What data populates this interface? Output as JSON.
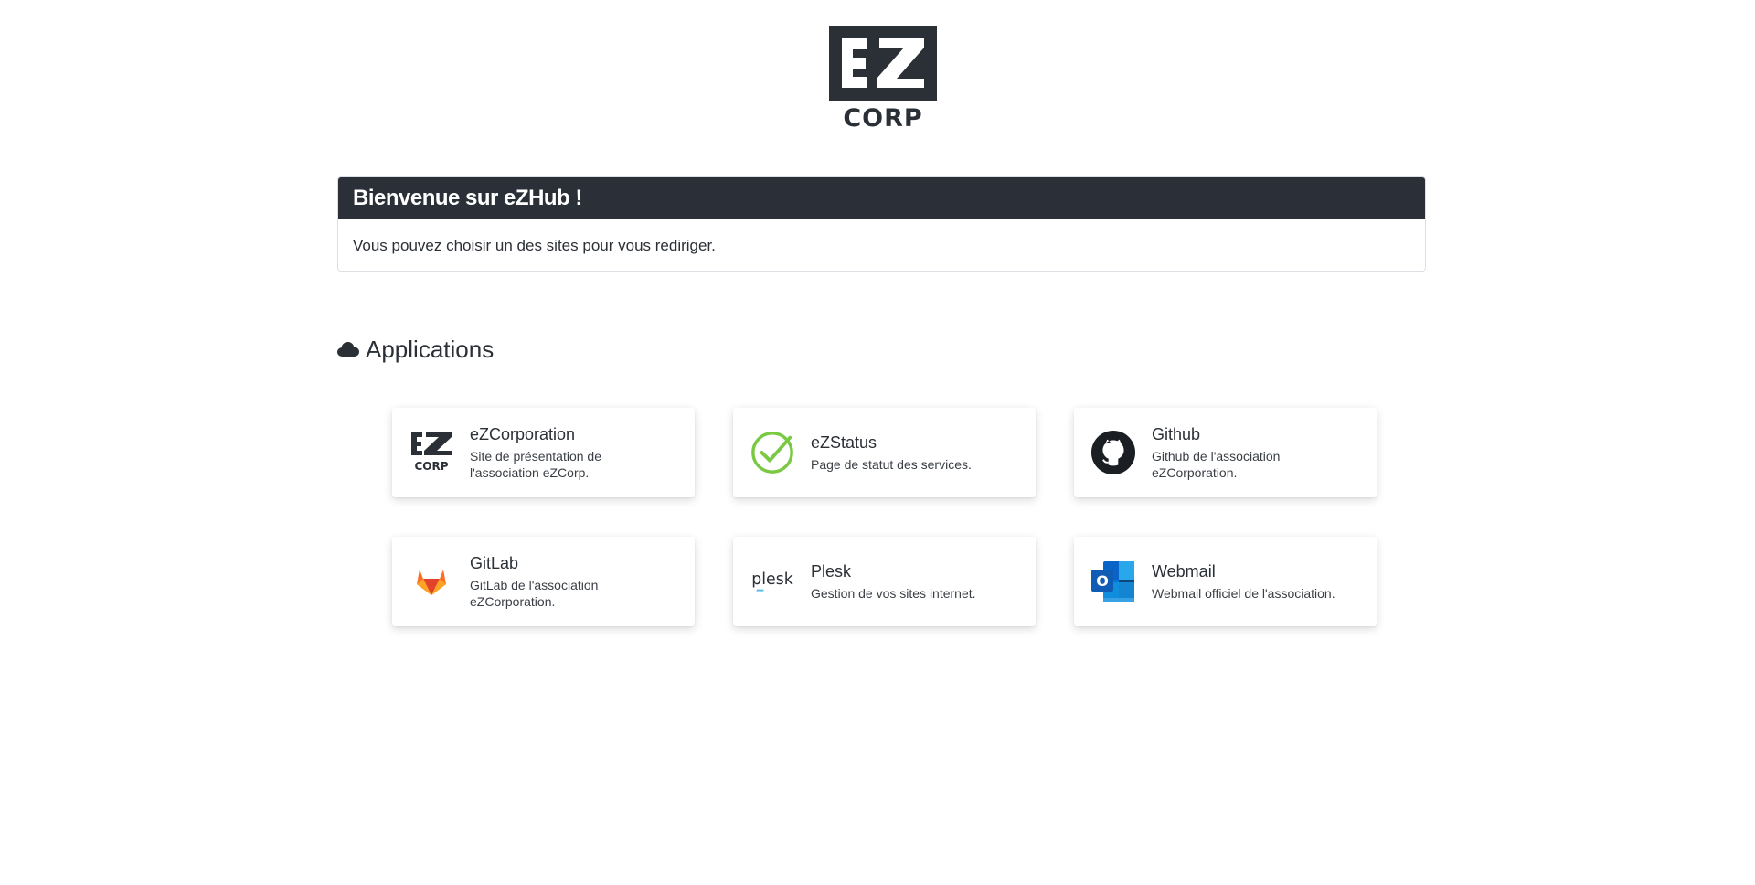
{
  "brand": {
    "logo_text_top": "EZ",
    "logo_text_bottom": "CORP"
  },
  "welcome": {
    "title": "Bienvenue sur eZHub !",
    "message": "Vous pouvez choisir un des sites pour vous rediriger."
  },
  "applications_section": {
    "icon": "cloud-icon",
    "title": "Applications"
  },
  "apps": [
    {
      "name": "eZCorporation",
      "description": "Site de présentation de l'association eZCorp.",
      "icon": "ezcorp-logo-icon"
    },
    {
      "name": "eZStatus",
      "description": "Page de statut des services.",
      "icon": "check-circle-icon"
    },
    {
      "name": "Github",
      "description": "Github de l'association eZCorporation.",
      "icon": "github-icon"
    },
    {
      "name": "GitLab",
      "description": "GitLab de l'association eZCorporation.",
      "icon": "gitlab-icon"
    },
    {
      "name": "Plesk",
      "description": "Gestion de vos sites internet.",
      "icon": "plesk-icon",
      "icon_text": "plesk"
    },
    {
      "name": "Webmail",
      "description": "Webmail officiel de l'association.",
      "icon": "outlook-icon",
      "icon_text": "O"
    }
  ],
  "colors": {
    "header_bg": "#2b3038",
    "status_green": "#7ac943",
    "gitlab_orange": "#e24329",
    "outlook_blue": "#0a64c8"
  }
}
